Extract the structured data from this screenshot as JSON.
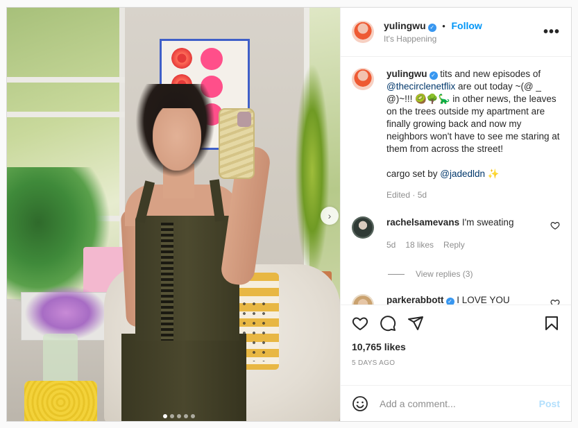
{
  "header": {
    "username": "yulingwu",
    "separator": "•",
    "follow_label": "Follow",
    "subtitle": "It's Happening",
    "more_label": "•••"
  },
  "caption": {
    "username": "yulingwu",
    "text_before": "tits and new episodes of ",
    "mention1": "@thecirclenetflix",
    "text_middle": " are out today ~(@ _ @)~!!! 🥝🌳🦕 in other news, the leaves on the trees outside my apartment are finally growing back and now my neighbors won't have to see me staring at them from across the street!\n\ncargo set by ",
    "mention2": "@jadedldn",
    "text_after": " ✨",
    "meta": "Edited · 5d"
  },
  "comments": [
    {
      "username": "rachelsamevans",
      "text": "I'm sweating",
      "age": "5d",
      "likes": "18 likes",
      "reply_label": "Reply",
      "view_replies": "View replies (3)"
    },
    {
      "username": "parkerabbott",
      "text": "I LOVE YOU"
    }
  ],
  "actions": {
    "icons": [
      "heart-icon",
      "comment-icon",
      "share-icon",
      "bookmark-icon"
    ],
    "likes": "10,765 likes",
    "date": "5 DAYS AGO"
  },
  "add_comment": {
    "placeholder": "Add a comment...",
    "post_label": "Post"
  },
  "carousel": {
    "slides": 5,
    "active_index": 0
  },
  "colors": {
    "link": "#0095f6",
    "mention": "#00376b",
    "verified": "#3897f0",
    "post_disabled": "#b2dffc"
  }
}
